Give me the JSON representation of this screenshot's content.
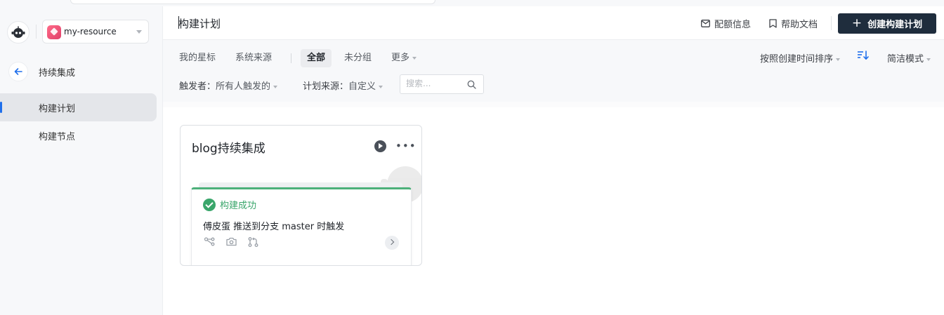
{
  "sidebar": {
    "resource_name": "my-resource",
    "section_title": "持续集成",
    "items": [
      {
        "label": "构建计划",
        "active": true
      },
      {
        "label": "构建节点",
        "active": false
      }
    ]
  },
  "header": {
    "title": "构建计划",
    "quota_label": "配额信息",
    "docs_label": "帮助文档",
    "create_label": "创建构建计划"
  },
  "filters": {
    "tabs": [
      {
        "label": "我的星标"
      },
      {
        "label": "系统来源"
      },
      {
        "label": "全部",
        "active": true
      },
      {
        "label": "未分组"
      },
      {
        "label": "更多"
      }
    ],
    "trigger_label": "触发者：",
    "trigger_value": "所有人触发的",
    "source_label": "计划来源：",
    "source_value": "自定义",
    "search_placeholder": "搜索...",
    "sort_label": "按照创建时间排序",
    "view_mode": "简洁模式"
  },
  "card": {
    "title": "blog持续集成",
    "status": "构建成功",
    "trigger_text": "傅皮蛋 推送到分支 master 时触发"
  },
  "colors": {
    "accent": "#1f6feb",
    "success": "#3aa66b",
    "primary_button": "#1f2d3d"
  }
}
